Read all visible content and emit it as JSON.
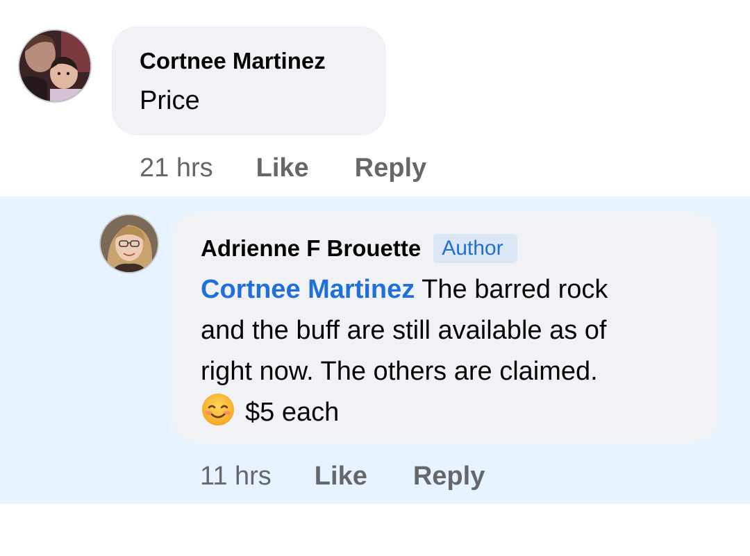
{
  "comments": [
    {
      "author": "Cortnee Martinez",
      "text": "Price",
      "time": "21 hrs",
      "like_label": "Like",
      "reply_label": "Reply"
    },
    {
      "author": "Adrienne F Brouette",
      "badge": "Author",
      "mention": "Cortnee Martinez",
      "text_line_1": "The barred rock",
      "text_line_2": "and the buff are still available as of",
      "text_line_3": "right now. The others are claimed.",
      "emoji": "smiling-face-with-blush-emoji",
      "text_line_4": "$5 each",
      "time": "11 hrs",
      "like_label": "Like",
      "reply_label": "Reply"
    }
  ],
  "colors": {
    "highlight_background": "#e7f3ff",
    "bubble_background": "#f0f2f5",
    "mention": "#216fdb",
    "meta_text": "#65676b"
  }
}
